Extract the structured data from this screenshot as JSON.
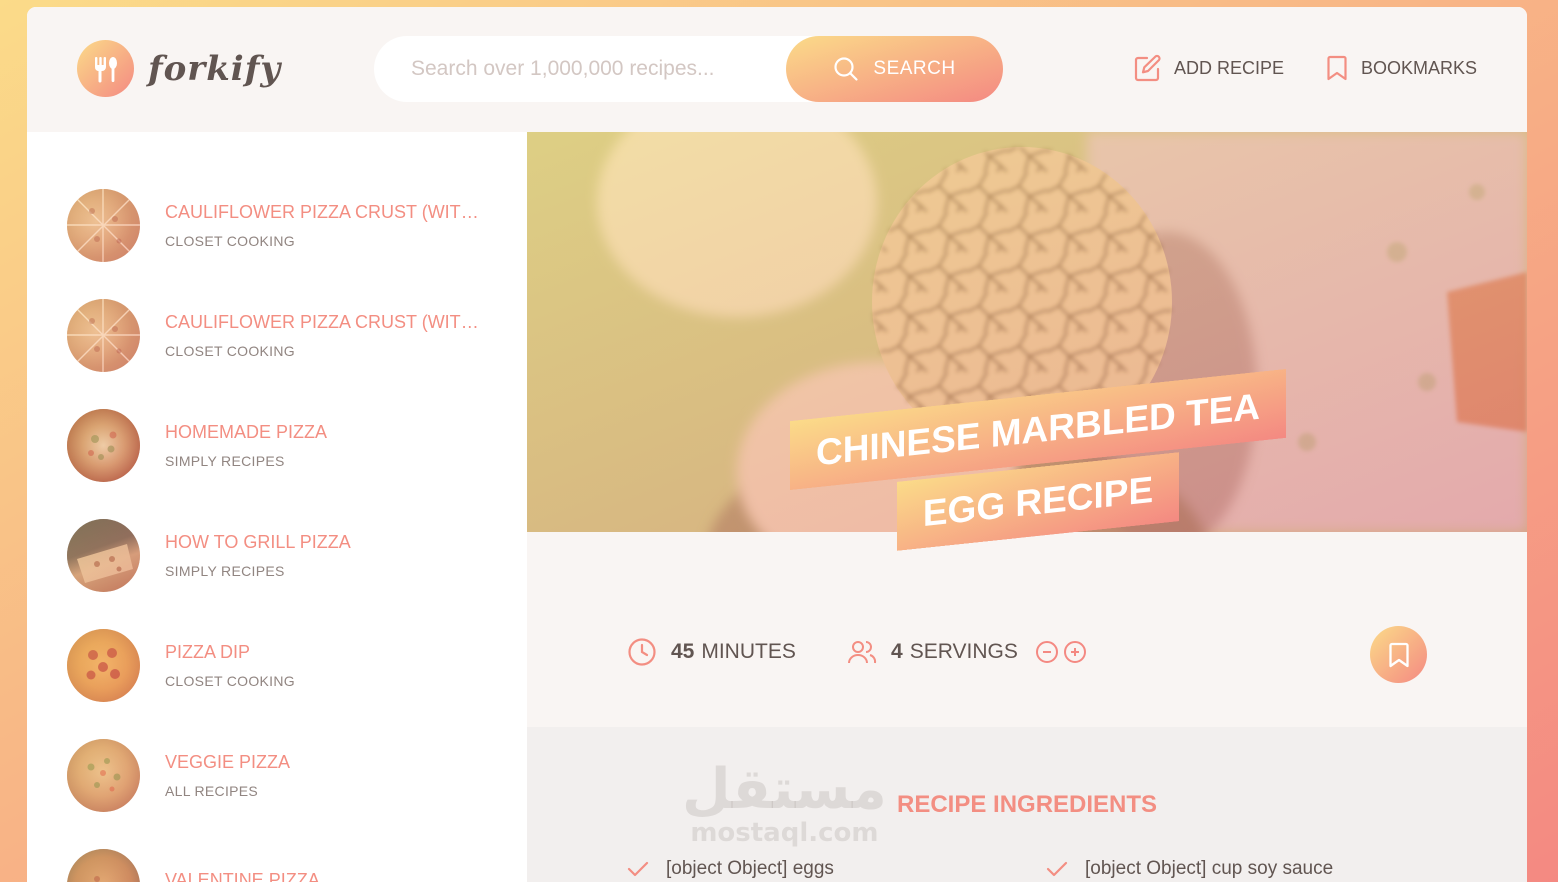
{
  "app": {
    "logo_text": "forkify"
  },
  "search": {
    "placeholder": "Search over 1,000,000 recipes...",
    "button_label": "SEARCH"
  },
  "nav": {
    "add_recipe": "ADD RECIPE",
    "bookmarks": "BOOKMARKS"
  },
  "results": [
    {
      "title": "CAULIFLOWER PIZZA CRUST (WITH BBQ CHICKEN PIZZA)",
      "publisher": "CLOSET COOKING"
    },
    {
      "title": "CAULIFLOWER PIZZA CRUST (WITH BBQ CHICKEN PIZZA)",
      "publisher": "CLOSET COOKING"
    },
    {
      "title": "HOMEMADE PIZZA",
      "publisher": "SIMPLY RECIPES"
    },
    {
      "title": "HOW TO GRILL PIZZA",
      "publisher": "SIMPLY RECIPES"
    },
    {
      "title": "PIZZA DIP",
      "publisher": "CLOSET COOKING"
    },
    {
      "title": "VEGGIE PIZZA",
      "publisher": "ALL RECIPES"
    },
    {
      "title": "VALENTINE PIZZA",
      "publisher": ""
    }
  ],
  "recipe": {
    "title": "CHINESE MARBLED TEA EGG RECIPE",
    "cooking_time": "45",
    "cooking_time_unit": "MINUTES",
    "servings": "4",
    "servings_unit": "SERVINGS",
    "ingredients_heading": "RECIPE INGREDIENTS",
    "ingredients": [
      "[object Object] eggs",
      "[object Object] cup soy sauce"
    ]
  },
  "watermark": {
    "arabic": "مستقل",
    "latin": "mostaql.com"
  },
  "colors": {
    "accent": "#f38e82",
    "gradient_start": "#fbdb89",
    "gradient_end": "#f48982",
    "text": "#615551"
  }
}
